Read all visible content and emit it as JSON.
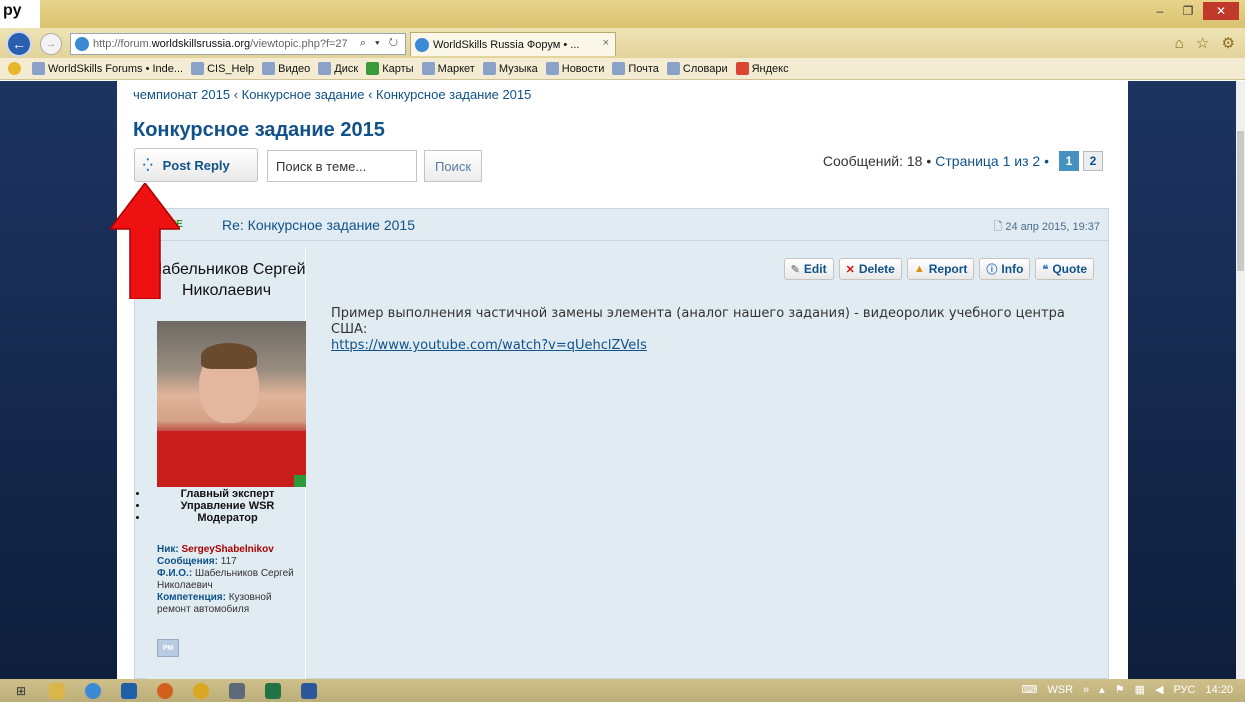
{
  "window": {
    "corner_label": "ру",
    "minimize": "–",
    "restore": "❐",
    "close": "✕"
  },
  "address_bar": {
    "url_prefix": "http://forum.",
    "url_domain": "worldskillsrussia.org",
    "url_suffix": "/viewtopic.php?f=27",
    "controls": "⌕ ▾ ↻"
  },
  "tab": {
    "title": "WorldSkills Russia Форум • ...",
    "close": "×"
  },
  "browser_icons": "⌂ ☆ ⚙",
  "favorites": [
    {
      "label": "WorldSkills Forums • Inde...",
      "icon": "worldskills-icon"
    },
    {
      "label": "CIS_Help",
      "icon": "cis-icon"
    },
    {
      "label": "Видео",
      "icon": "video-icon"
    },
    {
      "label": "Диск",
      "icon": "disk-icon"
    },
    {
      "label": "Карты",
      "icon": "maps-icon"
    },
    {
      "label": "Маркет",
      "icon": "market-icon"
    },
    {
      "label": "Музыка",
      "icon": "music-icon"
    },
    {
      "label": "Новости",
      "icon": "news-icon"
    },
    {
      "label": "Почта",
      "icon": "mail-icon"
    },
    {
      "label": "Словари",
      "icon": "dictionary-icon"
    },
    {
      "label": "Яндекс",
      "icon": "yandex-icon"
    }
  ],
  "forum": {
    "breadcrumb": "чемпионат 2015 ‹ Конкурсное задание ‹ Конкурсное задание 2015",
    "topic_title": "Конкурсное задание 2015",
    "post_reply_label": "Post Reply",
    "search_placeholder": "Поиск в теме...",
    "search_button": "Поиск",
    "pagination": {
      "count_text": "Сообщений: 18 •",
      "pages_text": "Страница 1 из 2 •",
      "pages": [
        "1",
        "2"
      ],
      "active_page": "1"
    }
  },
  "post": {
    "online_badge": "ONLINE",
    "subject": "Re: Конкурсное задание 2015",
    "date": "24 апр 2015, 19:37",
    "author_name": "Шабельников Сергей Николаевич",
    "ranks": [
      "Главный эксперт",
      "Управление WSR",
      "Модератор"
    ],
    "fields": {
      "nick_label": "Ник:",
      "nick_value": "SergeyShabelnikov",
      "posts_label": "Сообщения:",
      "posts_value": "117",
      "fio_label": "Ф.И.О.:",
      "fio_value": "Шабельников Сергей Николаевич",
      "competence_label": "Компетенция:",
      "competence_value": "Кузовной ремонт автомобиля"
    },
    "pm_label": "PM",
    "actions": [
      {
        "label": "Edit",
        "icon": "pencil-icon"
      },
      {
        "label": "Delete",
        "icon": "delete-icon"
      },
      {
        "label": "Report",
        "icon": "warning-icon"
      },
      {
        "label": "Info",
        "icon": "info-icon"
      },
      {
        "label": "Quote",
        "icon": "quote-icon"
      }
    ],
    "body_text": "Пример выполнения частичной замены элемента (аналог нашего задания) - видеоролик учебного центра США:",
    "body_link": "https://www.youtube.com/watch?v=qUehclZVeIs"
  },
  "taskbar": {
    "tray_lang": "WSR",
    "tray_arrows": "»",
    "input_lang": "РУС",
    "clock": "14:20"
  },
  "colors": {
    "link_blue": "#105289",
    "online_green": "#2f9a1f",
    "arrow_red": "#ee1111",
    "page_bg_navy": "#1a2c50"
  }
}
